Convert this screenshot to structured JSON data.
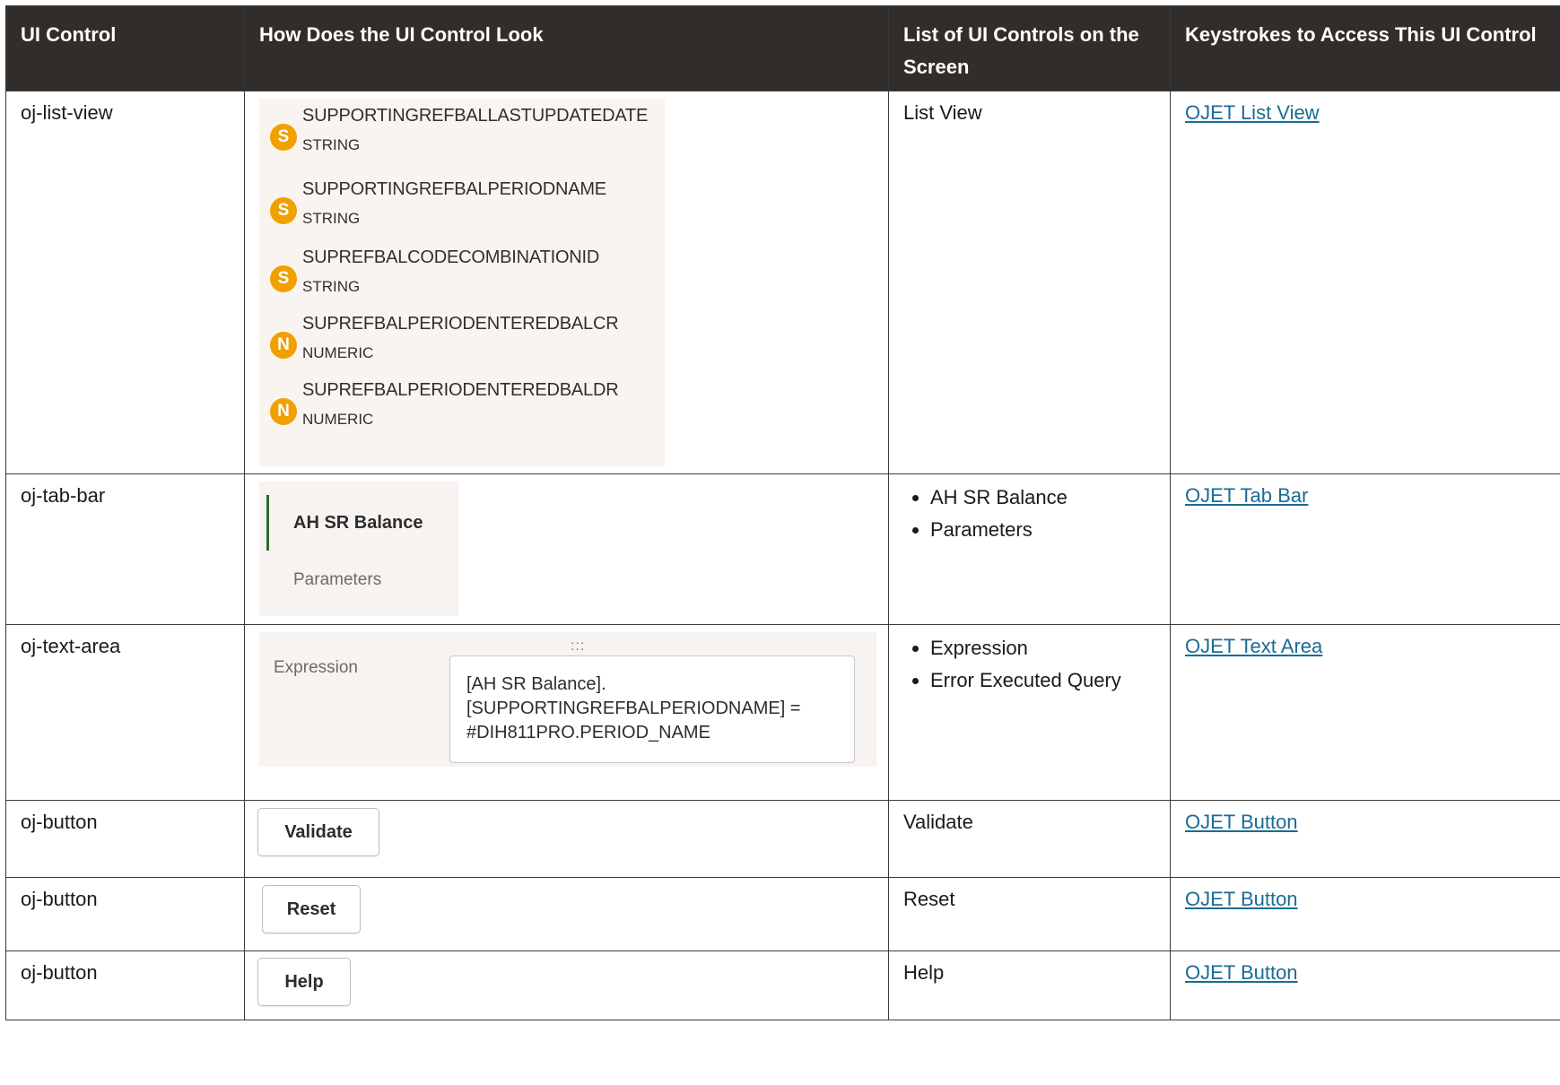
{
  "headers": {
    "ui_control": "UI Control",
    "look": "How Does the UI Control Look",
    "controls": "List of UI Controls on the Screen",
    "keystrokes": "Keystrokes to Access This UI Control"
  },
  "rows": [
    {
      "control": "oj-list-view",
      "controls_text": "List View",
      "link": "OJET List View"
    },
    {
      "control": "oj-tab-bar",
      "controls_items": [
        "AH SR Balance",
        "Parameters"
      ],
      "link": "OJET Tab Bar"
    },
    {
      "control": "oj-text-area",
      "controls_items": [
        "Expression",
        "Error Executed Query"
      ],
      "link": "OJET Text Area"
    },
    {
      "control": "oj-button",
      "controls_text": "Validate",
      "link": "OJET Button"
    },
    {
      "control": "oj-button",
      "controls_text": "Reset",
      "link": "OJET Button"
    },
    {
      "control": "oj-button",
      "controls_text": "Help",
      "link": "OJET Button"
    }
  ],
  "list_view": {
    "items": [
      {
        "badge": "S",
        "name": "SUPPORTINGREFBALLASTUPDATEDATE",
        "type": "STRING"
      },
      {
        "badge": "S",
        "name": "SUPPORTINGREFBALPERIODNAME",
        "type": "STRING"
      },
      {
        "badge": "S",
        "name": "SUPREFBALCODECOMBINATIONID",
        "type": "STRING"
      },
      {
        "badge": "N",
        "name": "SUPREFBALPERIODENTEREDBALCR",
        "type": "NUMERIC"
      },
      {
        "badge": "N",
        "name": "SUPREFBALPERIODENTEREDBALDR",
        "type": "NUMERIC"
      }
    ],
    "badge_color": "#f0a000"
  },
  "tab_bar": {
    "tabs": [
      "AH SR Balance",
      "Parameters"
    ],
    "indicator_color": "#2d6a2f"
  },
  "text_area": {
    "handle": ":::",
    "label": "Expression",
    "lines": [
      "[AH SR Balance].",
      "[SUPPORTINGREFBALPERIODNAME] =",
      "#DIH811PRO.PERIOD_NAME"
    ]
  },
  "buttons": {
    "validate": "Validate",
    "reset": "Reset",
    "help": "Help"
  },
  "colors": {
    "header_bg": "#312d2a",
    "link": "#1b6b94"
  }
}
